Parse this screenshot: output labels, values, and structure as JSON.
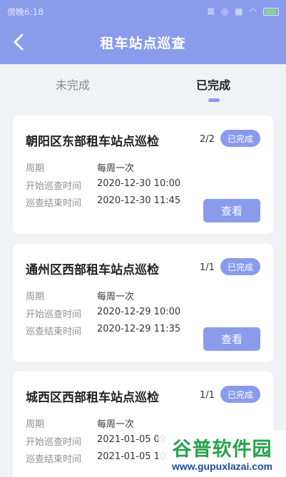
{
  "status_bar": {
    "time": "傍晚6:18"
  },
  "nav": {
    "title": "租车站点巡查"
  },
  "tabs": [
    {
      "label": "未完成",
      "active": false
    },
    {
      "label": "已完成",
      "active": true
    }
  ],
  "labels": {
    "period": "周期",
    "start": "开始巡查时间",
    "end": "巡查结束时间",
    "view_button": "查看"
  },
  "cards": [
    {
      "title": "朝阳区东部租车站点巡检",
      "count": "2/2",
      "status": "已完成",
      "period": "每周一次",
      "start": "2020-12-30 10:00",
      "end": "2020-12-30 11:45"
    },
    {
      "title": "通州区西部租车站点巡检",
      "count": "1/1",
      "status": "已完成",
      "period": "每周一次",
      "start": "2020-12-29 10:00",
      "end": "2020-12-29 11:35"
    },
    {
      "title": "城西区西部租车站点巡检",
      "count": "1/1",
      "status": "已完成",
      "period": "每周一次",
      "start": "2021-01-05 09",
      "end": "2021-01-05 10"
    }
  ],
  "watermark": {
    "top": "谷普软件园",
    "bottom": "www.gupuxlazai.com"
  },
  "colors": {
    "accent": "#8a9bec",
    "background": "#f0f2f6",
    "card": "#ffffff"
  }
}
